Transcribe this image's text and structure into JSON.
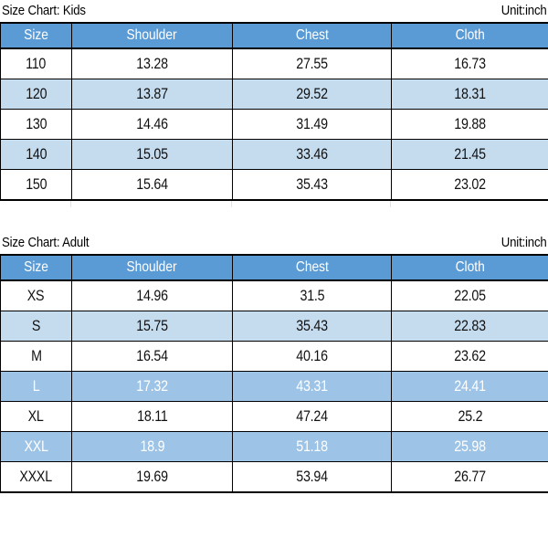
{
  "document": {
    "unit_label": "Unit:inch"
  },
  "charts": [
    {
      "id": "kids",
      "title": "Size Chart: Kids",
      "unit": "Unit:inch",
      "columns": [
        "Size",
        "Shoulder",
        "Chest",
        "Cloth"
      ],
      "rows": [
        {
          "style": "plain",
          "cells": [
            "110",
            "13.28",
            "27.55",
            "16.73"
          ]
        },
        {
          "style": "alt",
          "cells": [
            "120",
            "13.87",
            "29.52",
            "18.31"
          ]
        },
        {
          "style": "plain",
          "cells": [
            "130",
            "14.46",
            "31.49",
            "19.88"
          ]
        },
        {
          "style": "alt",
          "cells": [
            "140",
            "15.05",
            "33.46",
            "21.45"
          ]
        },
        {
          "style": "plain",
          "cells": [
            "150",
            "15.64",
            "35.43",
            "23.02"
          ]
        }
      ]
    },
    {
      "id": "adult",
      "title": "Size Chart: Adult",
      "unit": "Unit:inch",
      "columns": [
        "Size",
        "Shoulder",
        "Chest",
        "Cloth"
      ],
      "rows": [
        {
          "style": "plain",
          "cells": [
            "XS",
            "14.96",
            "31.5",
            "22.05"
          ]
        },
        {
          "style": "alt",
          "cells": [
            "S",
            "15.75",
            "35.43",
            "22.83"
          ]
        },
        {
          "style": "plain",
          "cells": [
            "M",
            "16.54",
            "40.16",
            "23.62"
          ]
        },
        {
          "style": "hi",
          "cells": [
            "L",
            "17.32",
            "43.31",
            "24.41"
          ]
        },
        {
          "style": "plain",
          "cells": [
            "XL",
            "18.11",
            "47.24",
            "25.2"
          ]
        },
        {
          "style": "hi",
          "cells": [
            "XXL",
            "18.9",
            "51.18",
            "25.98"
          ]
        },
        {
          "style": "plain",
          "cells": [
            "XXXL",
            "19.69",
            "53.94",
            "26.77"
          ]
        }
      ]
    }
  ],
  "colors": {
    "header_blue": "#5b9bd5",
    "row_alt_blue": "#c5dbee",
    "row_highlight_blue": "#9dc3e6",
    "text_dark": "#111111",
    "text_light": "#ffffff",
    "border": "#000000"
  }
}
